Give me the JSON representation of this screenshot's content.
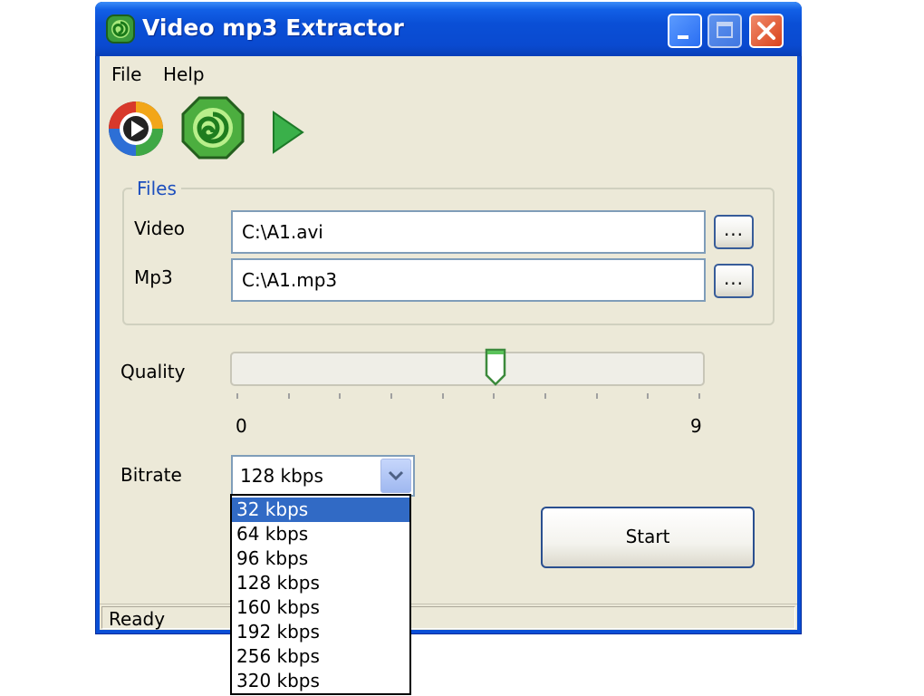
{
  "window": {
    "title": "Video mp3 Extractor"
  },
  "menu": {
    "items": [
      "File",
      "Help"
    ]
  },
  "toolbar": {
    "icons": [
      "media-player-icon",
      "extract-icon",
      "play-icon"
    ]
  },
  "files": {
    "group_title": "Files",
    "video_label": "Video",
    "video_value": "C:\\A1.avi",
    "mp3_label": "Mp3",
    "mp3_value": "C:\\A1.mp3",
    "browse_label": "..."
  },
  "quality": {
    "label": "Quality",
    "min_label": "0",
    "max_label": "9",
    "value": 5,
    "min": 0,
    "max": 9
  },
  "bitrate": {
    "label": "Bitrate",
    "selected": "128 kbps",
    "options": [
      "32 kbps",
      "64 kbps",
      "96 kbps",
      "128 kbps",
      "160 kbps",
      "192 kbps",
      "256 kbps",
      "320 kbps"
    ],
    "highlighted_index": 0
  },
  "start_label": "Start",
  "status": "Ready",
  "colors": {
    "titlebar": "#0a4fd6",
    "window_bg": "#ece9d8",
    "selection": "#316ac5",
    "group_title": "#1d4fbe",
    "close_button": "#d9431c"
  }
}
